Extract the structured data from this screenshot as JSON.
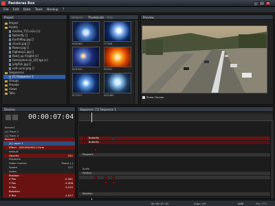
{
  "window": {
    "title": "Pandoras Box"
  },
  "menu": [
    "File",
    "Edit",
    "Data",
    "Tools",
    "Backup",
    "?"
  ],
  "project_panel": {
    "tab": "Project",
    "items": [
      {
        "label": "Project",
        "kind": "folder"
      },
      {
        "label": "Assets",
        "kind": "folder"
      },
      {
        "label": "Andrea_T15.m2v [c]",
        "kind": "file"
      },
      {
        "label": "Butterfly []",
        "kind": "file"
      },
      {
        "label": "EarthMap.jpg []",
        "kind": "file"
      },
      {
        "label": "clouds.jpg []",
        "kind": "file"
      },
      {
        "label": "flower.jpg []",
        "kind": "file"
      },
      {
        "label": "highway1.jpg []",
        "kind": "file"
      },
      {
        "label": "fixed_up freight [c]",
        "kind": "file"
      },
      {
        "label": "hemispherical_1[f].tga [c]",
        "kind": "file"
      },
      {
        "label": "jellyfish.jpg []",
        "kind": "file"
      },
      {
        "label": "soft coral.png []",
        "kind": "file"
      },
      {
        "label": "Sequences",
        "kind": "folder"
      },
      {
        "label": "[1] Sequence 1",
        "kind": "file",
        "selected": true
      },
      {
        "label": "Groups",
        "kind": "folder"
      },
      {
        "label": "Presets",
        "kind": "folder"
      },
      {
        "label": "Views",
        "kind": "folder"
      },
      {
        "label": "Tabs",
        "kind": "folder"
      }
    ]
  },
  "thumbnails_panel": {
    "tabs": [
      "Network",
      "Thumbnails",
      "Prop"
    ],
    "labels": [
      "f002565",
      "f77008",
      "f001000",
      "f00001",
      "f077027",
      "f001485"
    ]
  },
  "preview_panel": {
    "tab": "Preview",
    "show_canvas_label": "Show Canvas"
  },
  "devices_panel": {
    "tab": "Devices",
    "timecode": "00:00:07:04",
    "rows": [
      {
        "label": "Server1",
        "style": "plain"
      },
      {
        "label": "[1] Track 1",
        "style": "plain"
      },
      {
        "label": "[1] Track 2",
        "style": "plain"
      },
      {
        "label": "Server1",
        "style": "red"
      },
      {
        "label": "[1] Layer 1",
        "style": "sel"
      },
      {
        "label": "Effect - 0001634951115rm",
        "style": "red"
      },
      {
        "label": "default",
        "style": "plain"
      },
      {
        "label": "Opacity",
        "style": "red",
        "value": "241"
      },
      {
        "label": "Playback",
        "style": "plain"
      },
      {
        "label": "Video Control",
        "style": "plain",
        "value": "Pause [ ]"
      },
      {
        "label": "Speed",
        "style": "plain",
        "value": "127"
      },
      {
        "label": "Audio",
        "style": "plain"
      },
      {
        "label": "Position",
        "style": "red"
      },
      {
        "label": "X Pos",
        "style": "red",
        "value": "-0.261"
      },
      {
        "label": "Y Pos",
        "style": "red",
        "value": "-3.508"
      },
      {
        "label": "Z Pos",
        "style": "red",
        "value": "0.515"
      },
      {
        "label": "Rotation",
        "style": "red"
      },
      {
        "label": "X Rot",
        "style": "red",
        "value": "4.527"
      }
    ]
  },
  "sequence_panel": {
    "tab": "Sequence: [1] Sequence 1",
    "track_labels": [
      "Butterfly",
      "Butterfly",
      "Playback",
      "Audio",
      "Position",
      "Rotation"
    ]
  },
  "statusbar": {
    "timecode": "00:00:07:04",
    "mode": "Align: off",
    "live": "LIVE",
    "stop": "Rec ????"
  }
}
